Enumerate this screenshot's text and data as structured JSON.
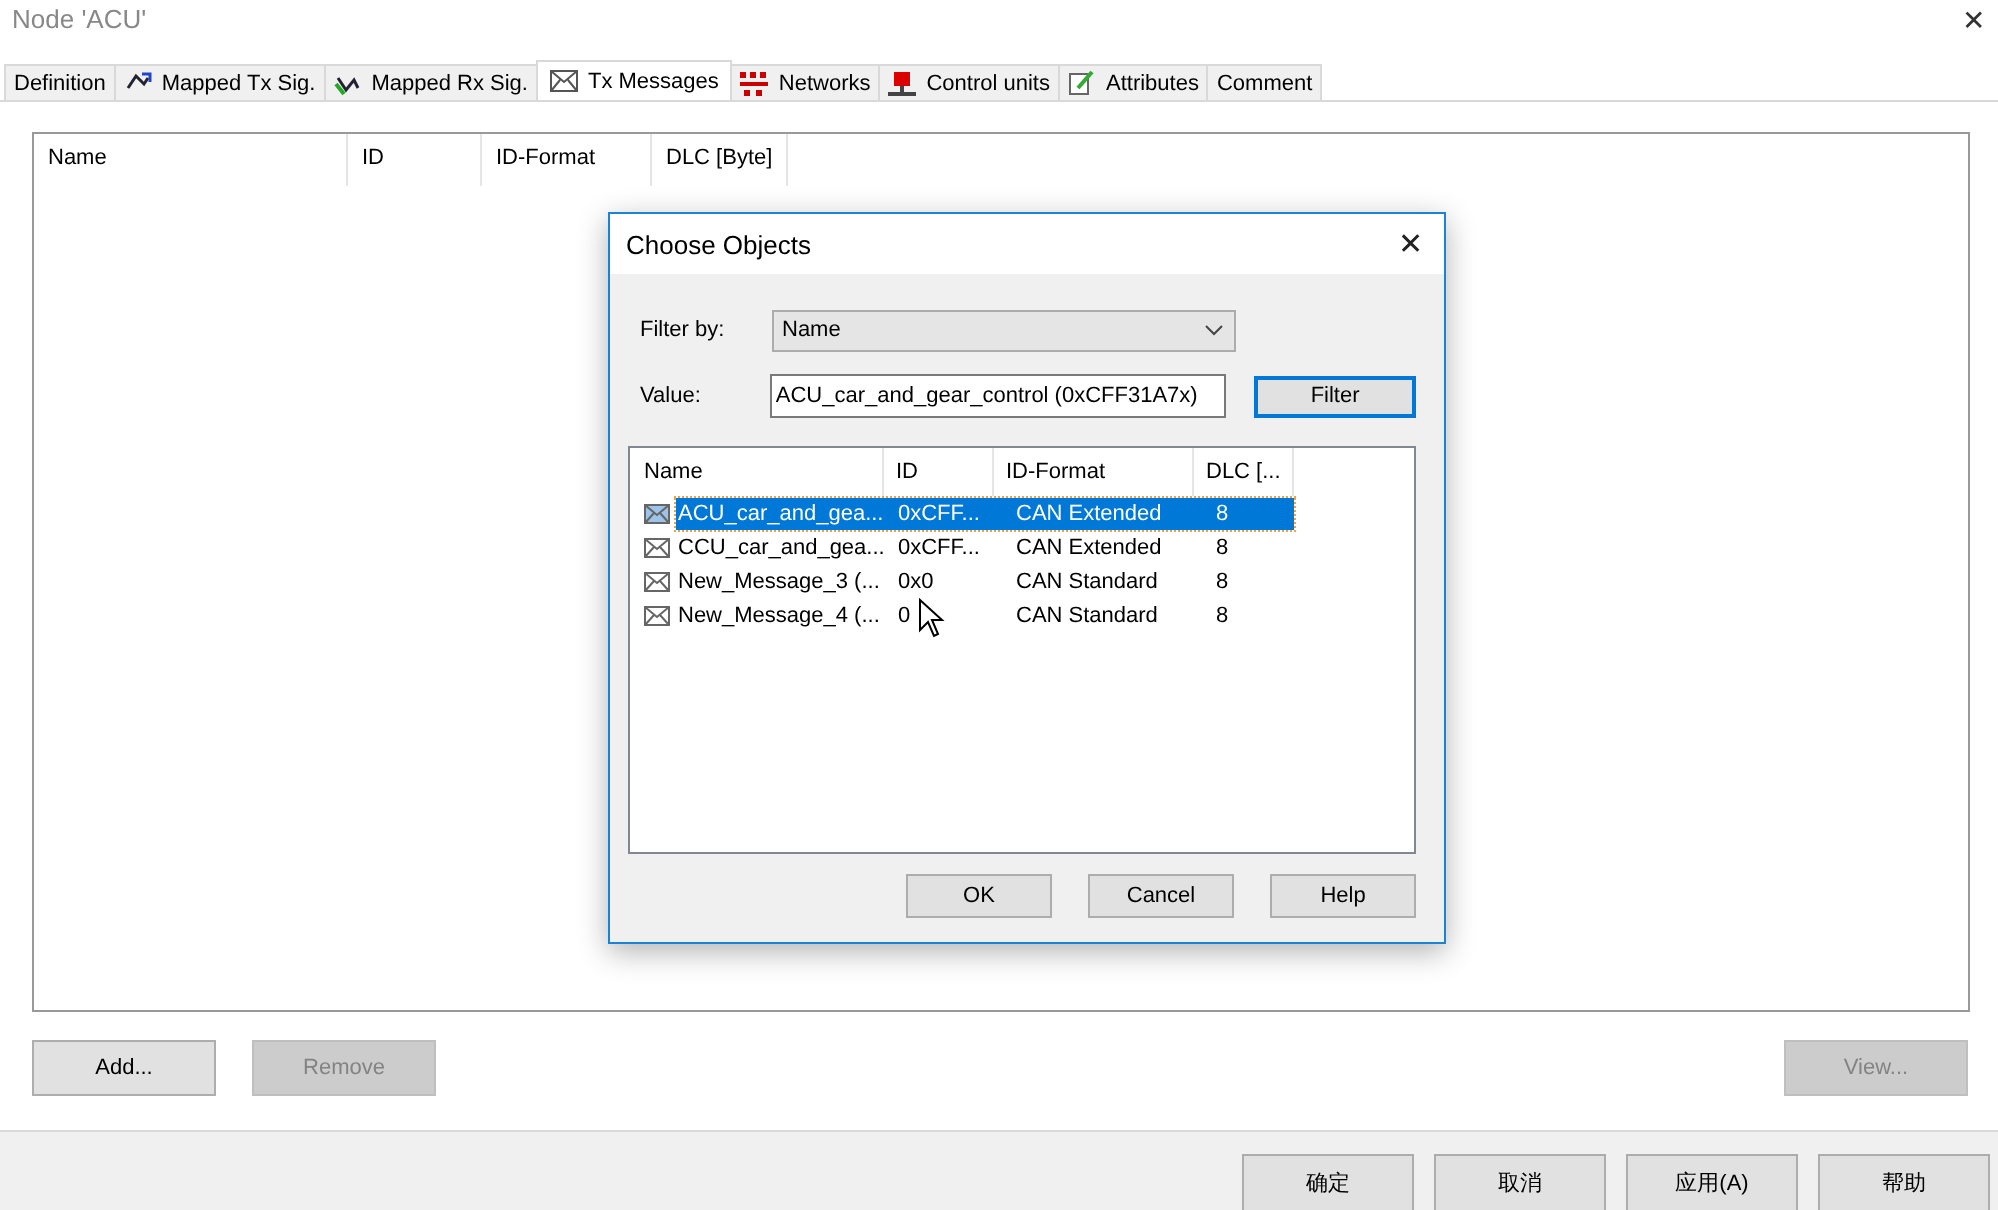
{
  "window": {
    "title": "Node 'ACU'",
    "close": "✕"
  },
  "tabs": [
    {
      "label": "Definition",
      "kind": "plain",
      "selected": false
    },
    {
      "label": "Mapped Tx Sig.",
      "kind": "txsig",
      "selected": false
    },
    {
      "label": "Mapped Rx Sig.",
      "kind": "rxsig",
      "selected": false
    },
    {
      "label": "Tx Messages",
      "kind": "messages",
      "selected": true
    },
    {
      "label": "Networks",
      "kind": "networks",
      "selected": false
    },
    {
      "label": "Control units",
      "kind": "units",
      "selected": false
    },
    {
      "label": "Attributes",
      "kind": "attributes",
      "selected": false
    },
    {
      "label": "Comment",
      "kind": "plain",
      "selected": false
    }
  ],
  "list": {
    "columns": [
      "Name",
      "ID",
      "ID-Format",
      "DLC [Byte]"
    ]
  },
  "list_buttons": [
    {
      "label": "Add...",
      "disabled": false
    },
    {
      "label": "Remove",
      "disabled": true
    },
    {
      "label": "View...",
      "disabled": true
    }
  ],
  "dialog": {
    "title": "Choose Objects",
    "close": "✕",
    "filter_label": "Filter by:",
    "filter_value": "Name",
    "value_label": "Value:",
    "value": "ACU_car_and_gear_control (0xCFF31A7x)",
    "filter_button": "Filter",
    "columns": [
      "Name",
      "ID",
      "ID-Format",
      "DLC [..."
    ],
    "rows": [
      {
        "name": "ACU_car_and_gea...",
        "id": "0xCFF...",
        "format": "CAN Extended",
        "dlc": "8",
        "selected": true
      },
      {
        "name": "CCU_car_and_gea...",
        "id": "0xCFF...",
        "format": "CAN Extended",
        "dlc": "8",
        "selected": false
      },
      {
        "name": "New_Message_3 (...",
        "id": "0x0",
        "format": "CAN Standard",
        "dlc": "8",
        "selected": false
      },
      {
        "name": "New_Message_4 (...",
        "id": "0",
        "format": "CAN Standard",
        "dlc": "8",
        "selected": false
      }
    ],
    "buttons": [
      "OK",
      "Cancel",
      "Help"
    ]
  },
  "footer_buttons": [
    "确定",
    "取消",
    "应用(A)",
    "帮助"
  ]
}
